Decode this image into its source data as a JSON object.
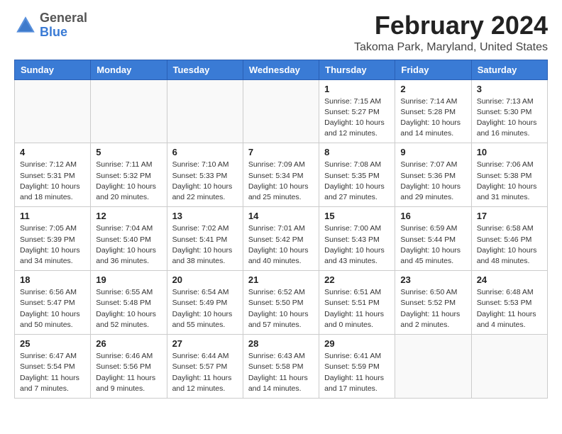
{
  "header": {
    "logo_general": "General",
    "logo_blue": "Blue",
    "month_title": "February 2024",
    "location": "Takoma Park, Maryland, United States"
  },
  "days_of_week": [
    "Sunday",
    "Monday",
    "Tuesday",
    "Wednesday",
    "Thursday",
    "Friday",
    "Saturday"
  ],
  "weeks": [
    [
      {
        "day": "",
        "info": ""
      },
      {
        "day": "",
        "info": ""
      },
      {
        "day": "",
        "info": ""
      },
      {
        "day": "",
        "info": ""
      },
      {
        "day": "1",
        "info": "Sunrise: 7:15 AM\nSunset: 5:27 PM\nDaylight: 10 hours\nand 12 minutes."
      },
      {
        "day": "2",
        "info": "Sunrise: 7:14 AM\nSunset: 5:28 PM\nDaylight: 10 hours\nand 14 minutes."
      },
      {
        "day": "3",
        "info": "Sunrise: 7:13 AM\nSunset: 5:30 PM\nDaylight: 10 hours\nand 16 minutes."
      }
    ],
    [
      {
        "day": "4",
        "info": "Sunrise: 7:12 AM\nSunset: 5:31 PM\nDaylight: 10 hours\nand 18 minutes."
      },
      {
        "day": "5",
        "info": "Sunrise: 7:11 AM\nSunset: 5:32 PM\nDaylight: 10 hours\nand 20 minutes."
      },
      {
        "day": "6",
        "info": "Sunrise: 7:10 AM\nSunset: 5:33 PM\nDaylight: 10 hours\nand 22 minutes."
      },
      {
        "day": "7",
        "info": "Sunrise: 7:09 AM\nSunset: 5:34 PM\nDaylight: 10 hours\nand 25 minutes."
      },
      {
        "day": "8",
        "info": "Sunrise: 7:08 AM\nSunset: 5:35 PM\nDaylight: 10 hours\nand 27 minutes."
      },
      {
        "day": "9",
        "info": "Sunrise: 7:07 AM\nSunset: 5:36 PM\nDaylight: 10 hours\nand 29 minutes."
      },
      {
        "day": "10",
        "info": "Sunrise: 7:06 AM\nSunset: 5:38 PM\nDaylight: 10 hours\nand 31 minutes."
      }
    ],
    [
      {
        "day": "11",
        "info": "Sunrise: 7:05 AM\nSunset: 5:39 PM\nDaylight: 10 hours\nand 34 minutes."
      },
      {
        "day": "12",
        "info": "Sunrise: 7:04 AM\nSunset: 5:40 PM\nDaylight: 10 hours\nand 36 minutes."
      },
      {
        "day": "13",
        "info": "Sunrise: 7:02 AM\nSunset: 5:41 PM\nDaylight: 10 hours\nand 38 minutes."
      },
      {
        "day": "14",
        "info": "Sunrise: 7:01 AM\nSunset: 5:42 PM\nDaylight: 10 hours\nand 40 minutes."
      },
      {
        "day": "15",
        "info": "Sunrise: 7:00 AM\nSunset: 5:43 PM\nDaylight: 10 hours\nand 43 minutes."
      },
      {
        "day": "16",
        "info": "Sunrise: 6:59 AM\nSunset: 5:44 PM\nDaylight: 10 hours\nand 45 minutes."
      },
      {
        "day": "17",
        "info": "Sunrise: 6:58 AM\nSunset: 5:46 PM\nDaylight: 10 hours\nand 48 minutes."
      }
    ],
    [
      {
        "day": "18",
        "info": "Sunrise: 6:56 AM\nSunset: 5:47 PM\nDaylight: 10 hours\nand 50 minutes."
      },
      {
        "day": "19",
        "info": "Sunrise: 6:55 AM\nSunset: 5:48 PM\nDaylight: 10 hours\nand 52 minutes."
      },
      {
        "day": "20",
        "info": "Sunrise: 6:54 AM\nSunset: 5:49 PM\nDaylight: 10 hours\nand 55 minutes."
      },
      {
        "day": "21",
        "info": "Sunrise: 6:52 AM\nSunset: 5:50 PM\nDaylight: 10 hours\nand 57 minutes."
      },
      {
        "day": "22",
        "info": "Sunrise: 6:51 AM\nSunset: 5:51 PM\nDaylight: 11 hours\nand 0 minutes."
      },
      {
        "day": "23",
        "info": "Sunrise: 6:50 AM\nSunset: 5:52 PM\nDaylight: 11 hours\nand 2 minutes."
      },
      {
        "day": "24",
        "info": "Sunrise: 6:48 AM\nSunset: 5:53 PM\nDaylight: 11 hours\nand 4 minutes."
      }
    ],
    [
      {
        "day": "25",
        "info": "Sunrise: 6:47 AM\nSunset: 5:54 PM\nDaylight: 11 hours\nand 7 minutes."
      },
      {
        "day": "26",
        "info": "Sunrise: 6:46 AM\nSunset: 5:56 PM\nDaylight: 11 hours\nand 9 minutes."
      },
      {
        "day": "27",
        "info": "Sunrise: 6:44 AM\nSunset: 5:57 PM\nDaylight: 11 hours\nand 12 minutes."
      },
      {
        "day": "28",
        "info": "Sunrise: 6:43 AM\nSunset: 5:58 PM\nDaylight: 11 hours\nand 14 minutes."
      },
      {
        "day": "29",
        "info": "Sunrise: 6:41 AM\nSunset: 5:59 PM\nDaylight: 11 hours\nand 17 minutes."
      },
      {
        "day": "",
        "info": ""
      },
      {
        "day": "",
        "info": ""
      }
    ]
  ]
}
